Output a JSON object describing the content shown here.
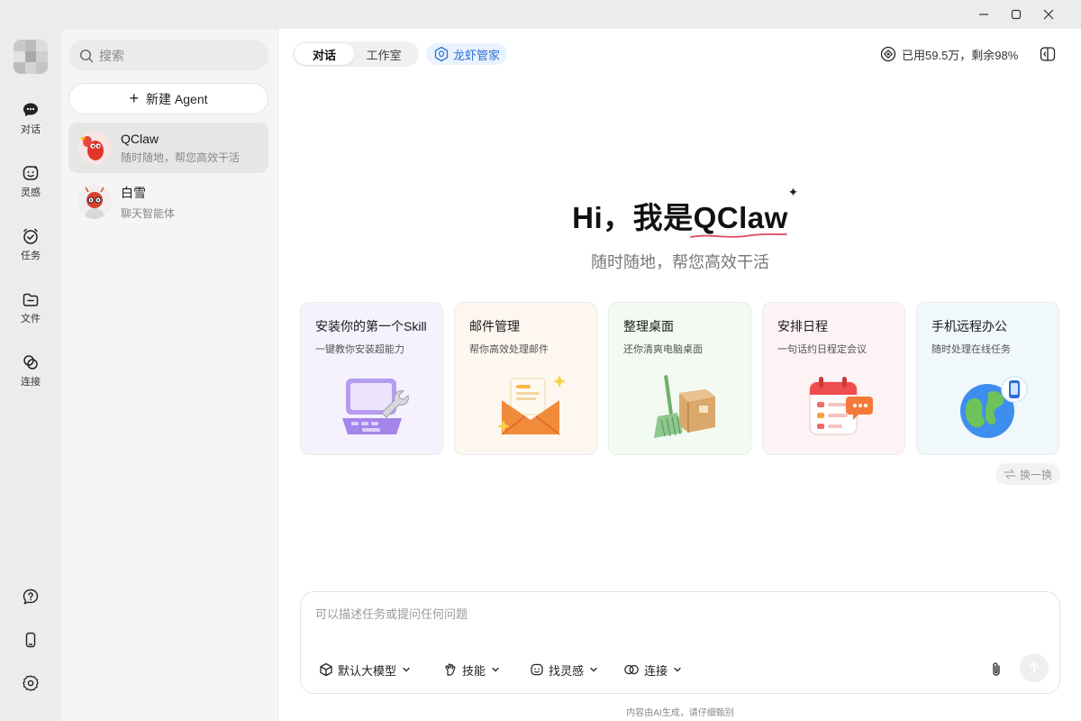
{
  "rail": {
    "items": [
      {
        "label": "对话",
        "icon": "chat-icon"
      },
      {
        "label": "灵感",
        "icon": "inspiration-icon"
      },
      {
        "label": "任务",
        "icon": "task-icon"
      },
      {
        "label": "文件",
        "icon": "folder-icon"
      },
      {
        "label": "连接",
        "icon": "link-icon"
      }
    ],
    "bottom": [
      "help-icon",
      "phone-icon",
      "settings-icon"
    ]
  },
  "sidebar": {
    "search_placeholder": "搜索",
    "new_agent_label": "新建 Agent",
    "agents": [
      {
        "name": "QClaw",
        "desc": "随时随地，帮您高效干活",
        "active": true
      },
      {
        "name": "白雪",
        "desc": "聊天智能体",
        "active": false
      }
    ]
  },
  "header": {
    "tabs": [
      "对话",
      "工作室"
    ],
    "active_tab": "对话",
    "butler_label": "龙虾管家",
    "usage_text": "已用59.5万，剩余98%"
  },
  "hero": {
    "title": "Hi，我是QClaw",
    "subtitle": "随时随地，帮您高效干活"
  },
  "cards": [
    {
      "title": "安装你的第一个Skill",
      "desc": "一键教你安装超能力",
      "icon": "laptop-wrench-icon",
      "bg": "#f5f2fd"
    },
    {
      "title": "邮件管理",
      "desc": "帮你高效处理邮件",
      "icon": "envelope-icon",
      "bg": "#fdf7f0"
    },
    {
      "title": "整理桌面",
      "desc": "还你清爽电脑桌面",
      "icon": "broom-box-icon",
      "bg": "#f2faf2"
    },
    {
      "title": "安排日程",
      "desc": "一句话约日程定会议",
      "icon": "calendar-icon",
      "bg": "#fdf3f4"
    },
    {
      "title": "手机远程办公",
      "desc": "随时处理在线任务",
      "icon": "globe-phone-icon",
      "bg": "#f0f8fc"
    }
  ],
  "shuffle_label": "换一换",
  "composer": {
    "placeholder": "可以描述任务或提问任何问题",
    "chips": [
      {
        "label": "默认大模型",
        "icon": "cube-icon"
      },
      {
        "label": "技能",
        "icon": "skill-icon"
      },
      {
        "label": "找灵感",
        "icon": "inspiration-icon"
      },
      {
        "label": "连接",
        "icon": "link-icon"
      }
    ]
  },
  "footer_note": "内容由AI生成，请仔细甄别",
  "colors": {
    "accent_blue": "#2b72d8",
    "qclaw_red": "#e0352b",
    "underline": "#e04a5a"
  }
}
